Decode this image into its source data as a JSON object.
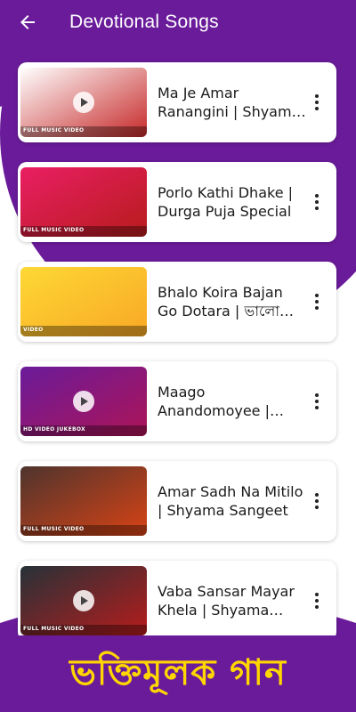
{
  "header": {
    "title": "Devotional Songs",
    "back_icon": "arrow-left-icon"
  },
  "songs": [
    {
      "title": "Ma Je Amar Ranangini | Shyama Sangeet",
      "thumb_tag": "FULL MUSIC VIDEO",
      "thumb_colors": [
        "#ffffff",
        "#c62828"
      ]
    },
    {
      "title": "Porlo Kathi Dhake | Durga Puja Special",
      "thumb_tag": "FULL MUSIC VIDEO",
      "thumb_colors": [
        "#e91e63",
        "#b71c1c"
      ]
    },
    {
      "title": "Bhalo Koira Bajan Go Dotara | ভালো কইরা বাজান গো দোতারা",
      "thumb_tag": "VIDEO",
      "thumb_colors": [
        "#fdd835",
        "#f9a825"
      ]
    },
    {
      "title": "Maago Anandomoyee | Bengali Devotional",
      "thumb_tag": "HD VIDEO JUKEBOX",
      "thumb_colors": [
        "#6a1b9a",
        "#ad1457"
      ]
    },
    {
      "title": "Amar Sadh Na Mitilo | Shyama Sangeet",
      "thumb_tag": "FULL MUSIC VIDEO",
      "thumb_colors": [
        "#4e342e",
        "#d84315"
      ]
    },
    {
      "title": "Vaba Sansar Mayar Khela | Shyama Sangeet",
      "thumb_tag": "FULL MUSIC VIDEO",
      "thumb_colors": [
        "#263238",
        "#b71c1c"
      ]
    }
  ],
  "banner": {
    "text": "ভক্তিমূলক গান"
  },
  "colors": {
    "primary": "#6a1b9a",
    "banner_text": "#ffd600",
    "card_bg": "#ffffff"
  }
}
